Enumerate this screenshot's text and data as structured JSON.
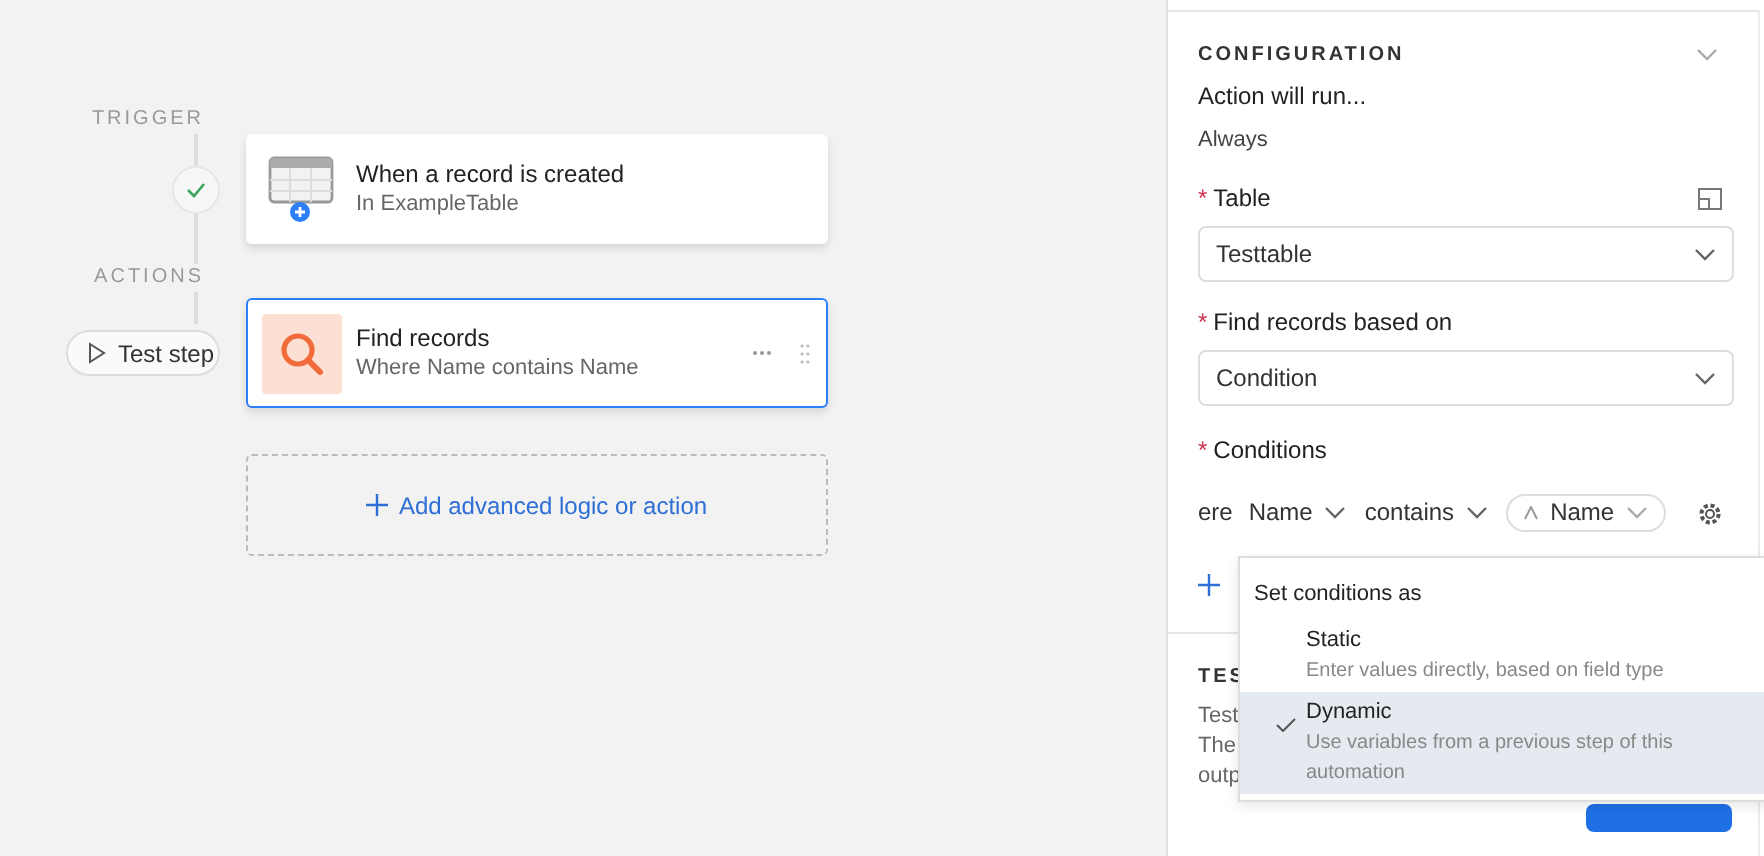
{
  "trigger": {
    "section_label": "TRIGGER",
    "title": "When a record is created",
    "subtitle": "In ExampleTable",
    "completed": true
  },
  "actions": {
    "section_label": "ACTIONS",
    "test_button": "Test step",
    "steps": [
      {
        "title": "Find records",
        "subtitle": "Where Name contains Name",
        "selected": true
      }
    ],
    "add_button": "Add advanced logic or action"
  },
  "panel": {
    "section_title": "CONFIGURATION",
    "run_label": "Action will run...",
    "run_value": "Always",
    "fields": [
      {
        "label": "Table",
        "required_mark": "*",
        "value": "Testtable"
      },
      {
        "label": "Find records based on",
        "required_mark": "*",
        "value": "Condition"
      }
    ],
    "conditions": {
      "label": "Conditions",
      "required_mark": "*",
      "prefix": "ere",
      "field": "Name",
      "operator": "contains",
      "value": "Name"
    },
    "test_section": {
      "title": "TES",
      "lines": [
        "Test",
        "The",
        "outp"
      ]
    }
  },
  "menu": {
    "title": "Set conditions as",
    "options": [
      {
        "label": "Static",
        "description": "Enter values directly, based on field type",
        "selected": false
      },
      {
        "label": "Dynamic",
        "description": "Use variables from a previous step of this automation",
        "selected": true
      }
    ]
  }
}
